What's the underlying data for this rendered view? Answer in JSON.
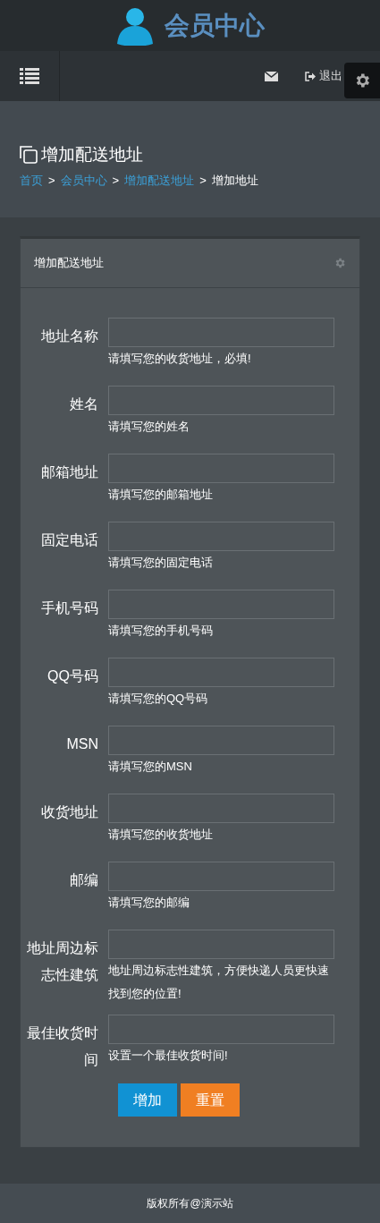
{
  "header": {
    "title": "会员中心"
  },
  "navbar": {
    "logout": "退出"
  },
  "page_header": {
    "title": "增加配送地址",
    "separator": ">",
    "breadcrumb": [
      {
        "label": "首页",
        "link": true
      },
      {
        "label": "会员中心",
        "link": true
      },
      {
        "label": "增加配送地址",
        "link": true
      },
      {
        "label": "增加地址",
        "link": false
      }
    ]
  },
  "card": {
    "title": "增加配送地址",
    "fields": [
      {
        "label": "地址名称",
        "help": "请填写您的收货地址，必填!"
      },
      {
        "label": "姓名",
        "help": "请填写您的姓名"
      },
      {
        "label": "邮箱地址",
        "help": "请填写您的邮箱地址"
      },
      {
        "label": "固定电话",
        "help": "请填写您的固定电话"
      },
      {
        "label": "手机号码",
        "help": "请填写您的手机号码"
      },
      {
        "label": "QQ号码",
        "help": "请填写您的QQ号码"
      },
      {
        "label": "MSN",
        "help": "请填写您的MSN"
      },
      {
        "label": "收货地址",
        "help": "请填写您的收货地址"
      },
      {
        "label": "邮编",
        "help": "请填写您的邮编"
      },
      {
        "label": "地址周边标志性建筑",
        "help": "地址周边标志性建筑，方便快递人员更快速找到您的位置!"
      },
      {
        "label": "最佳收货时间",
        "help": "设置一个最佳收货时间!"
      }
    ],
    "buttons": [
      {
        "label": "增加",
        "kind": "primary"
      },
      {
        "label": "重置",
        "kind": "warning"
      }
    ]
  },
  "footer": {
    "text": "版权所有@演示站"
  }
}
